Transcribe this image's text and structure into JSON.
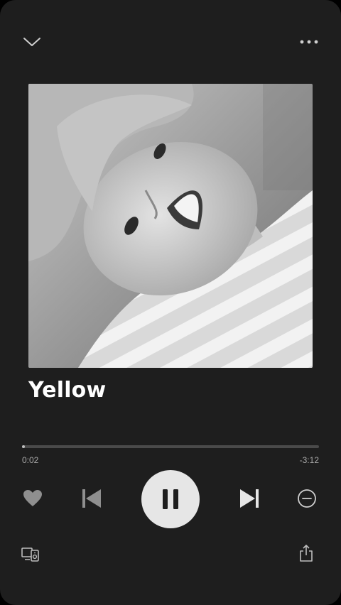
{
  "player": {
    "track": {
      "title": "Yellow"
    },
    "playback": {
      "elapsed": "0:02",
      "remaining": "-3:12",
      "progress_fraction": 0.01,
      "state": "playing"
    },
    "top_bar": {
      "collapse_icon": "chevron-down-icon",
      "more_icon": "more-horizontal-icon"
    },
    "controls": {
      "like_icon": "heart-icon",
      "previous_icon": "skip-previous-icon",
      "play_pause_icon": "pause-icon",
      "next_icon": "skip-next-icon",
      "remove_icon": "minus-circle-icon"
    },
    "bottom_bar": {
      "devices_icon": "devices-icon",
      "share_icon": "share-icon"
    },
    "colors": {
      "background": "#1e1e1e",
      "title": "#ffffff",
      "accent_button": "#e6e6e6",
      "track": "#4a4a4a",
      "track_fill": "#bdbdbd",
      "secondary_text": "#a8a8a8"
    }
  }
}
